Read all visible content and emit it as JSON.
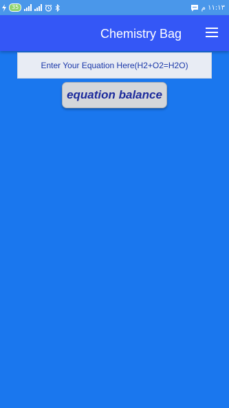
{
  "status_bar": {
    "time": "١١:١٣ م",
    "battery_level": "35",
    "icons": [
      "charging-icon",
      "signal-icon",
      "signal-icon",
      "alarm-icon",
      "bluetooth-icon",
      "message-icon"
    ]
  },
  "app_bar": {
    "title": "Chemistry Bag",
    "menu_icon": "hamburger-menu-icon"
  },
  "equation": {
    "placeholder": "Enter Your Equation Here(H2+O2=H2O)",
    "value": ""
  },
  "balance_button": {
    "label": "equation balance"
  },
  "colors": {
    "background": "#1a77ee",
    "app_bar": "#3457f6",
    "status_bar": "#4a97ea",
    "input_text": "#1836a8",
    "button_text": "#1b2a9c"
  }
}
